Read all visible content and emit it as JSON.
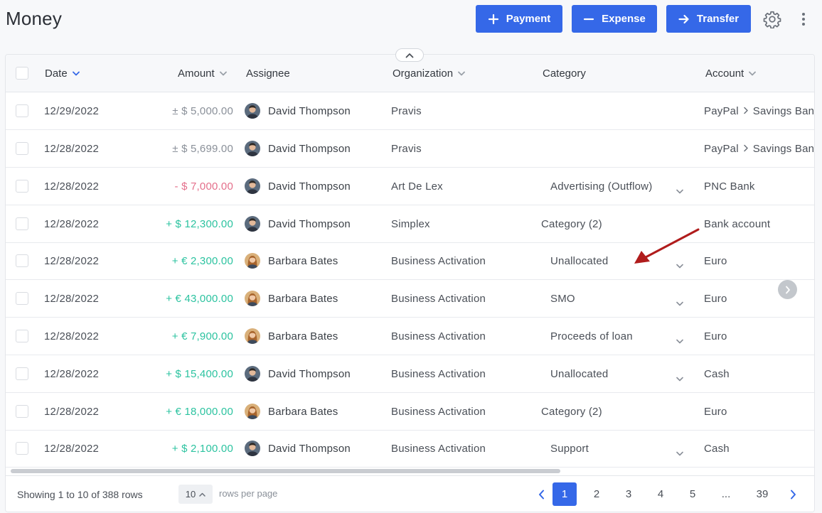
{
  "header": {
    "title": "Money",
    "payment_label": "Payment",
    "expense_label": "Expense",
    "transfer_label": "Transfer"
  },
  "colors": {
    "accent": "#3568e8",
    "positive": "#2cc3a0",
    "negative": "#e46f8b",
    "neutral": "#8a9099",
    "annotation_arrow": "#b01c1c"
  },
  "icons": {
    "payment": "plus-icon",
    "expense": "minus-icon",
    "transfer": "arrow-right-icon",
    "settings": "gear-icon",
    "more": "kebab-icon"
  },
  "table": {
    "columns": {
      "date": "Date",
      "amount": "Amount",
      "assignee": "Assignee",
      "organization": "Organization",
      "category": "Category",
      "account": "Account"
    },
    "rows": [
      {
        "date": "12/29/2022",
        "amount": "± $ 5,000.00",
        "amount_kind": "neutral",
        "assignee": "David Thompson",
        "avatar": "male",
        "organization": "Pravis",
        "category": "",
        "category_dropdown": false,
        "account_parts": [
          "PayPal",
          "Savings Bank"
        ]
      },
      {
        "date": "12/28/2022",
        "amount": "± $ 5,699.00",
        "amount_kind": "neutral",
        "assignee": "David Thompson",
        "avatar": "male",
        "organization": "Pravis",
        "category": "",
        "category_dropdown": false,
        "account_parts": [
          "PayPal",
          "Savings Bank"
        ]
      },
      {
        "date": "12/28/2022",
        "amount": "- $ 7,000.00",
        "amount_kind": "negative",
        "assignee": "David Thompson",
        "avatar": "male",
        "organization": "Art De Lex",
        "category": "Advertising (Outflow)",
        "category_dropdown": true,
        "account_parts": [
          "PNC Bank"
        ]
      },
      {
        "date": "12/28/2022",
        "amount": "+ $ 12,300.00",
        "amount_kind": "positive",
        "assignee": "David Thompson",
        "avatar": "male",
        "organization": "Simplex",
        "category": "Category (2)",
        "category_dropdown": false,
        "account_parts": [
          "Bank account"
        ]
      },
      {
        "date": "12/28/2022",
        "amount": "+ € 2,300.00",
        "amount_kind": "positive",
        "assignee": "Barbara Bates",
        "avatar": "female",
        "organization": "Business Activation",
        "category": "Unallocated",
        "category_dropdown": true,
        "account_parts": [
          "Euro"
        ]
      },
      {
        "date": "12/28/2022",
        "amount": "+ € 43,000.00",
        "amount_kind": "positive",
        "assignee": "Barbara Bates",
        "avatar": "female",
        "organization": "Business Activation",
        "category": "SMO",
        "category_dropdown": true,
        "account_parts": [
          "Euro"
        ]
      },
      {
        "date": "12/28/2022",
        "amount": "+ € 7,900.00",
        "amount_kind": "positive",
        "assignee": "Barbara Bates",
        "avatar": "female",
        "organization": "Business Activation",
        "category": "Proceeds of loan",
        "category_dropdown": true,
        "account_parts": [
          "Euro"
        ]
      },
      {
        "date": "12/28/2022",
        "amount": "+ $ 15,400.00",
        "amount_kind": "positive",
        "assignee": "David Thompson",
        "avatar": "male",
        "organization": "Business Activation",
        "category": "Unallocated",
        "category_dropdown": true,
        "account_parts": [
          "Cash"
        ]
      },
      {
        "date": "12/28/2022",
        "amount": "+ € 18,000.00",
        "amount_kind": "positive",
        "assignee": "Barbara Bates",
        "avatar": "female",
        "organization": "Business Activation",
        "category": "Category (2)",
        "category_dropdown": false,
        "account_parts": [
          "Euro"
        ]
      },
      {
        "date": "12/28/2022",
        "amount": "+ $ 2,100.00",
        "amount_kind": "positive",
        "assignee": "David Thompson",
        "avatar": "male",
        "organization": "Business Activation",
        "category": "Support",
        "category_dropdown": true,
        "account_parts": [
          "Cash"
        ]
      }
    ]
  },
  "footer": {
    "showing": "Showing 1 to 10 of 388 rows",
    "per_page_value": "10",
    "per_page_label": "rows per page",
    "pages": [
      "1",
      "2",
      "3",
      "4",
      "5",
      "...",
      "39"
    ],
    "active_page": "1"
  }
}
